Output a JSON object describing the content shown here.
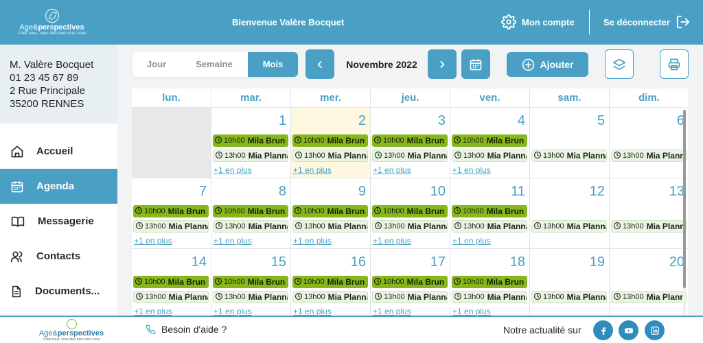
{
  "header": {
    "brand_part1": "Age&",
    "brand_part2": "perspectives",
    "brand_tagline": "Chez nous, vous êtes bien chez vous",
    "welcome": "Bienvenue Valère Bocquet",
    "account": "Mon compte",
    "logout": "Se déconnecter"
  },
  "sidebar": {
    "address": [
      "M. Valère Bocquet",
      "01 23 45 67 89",
      "2 Rue Principale",
      "35200 RENNES"
    ],
    "items": [
      {
        "label": "Accueil",
        "icon": "home-icon",
        "active": false
      },
      {
        "label": "Agenda",
        "icon": "calendar-icon",
        "active": true
      },
      {
        "label": "Messagerie",
        "icon": "book-icon",
        "active": false
      },
      {
        "label": "Contacts",
        "icon": "users-icon",
        "active": false
      },
      {
        "label": "Documents...",
        "icon": "document-icon",
        "active": false
      }
    ]
  },
  "toolbar": {
    "views": [
      "Jour",
      "Semaine",
      "Mois"
    ],
    "active_view": "Mois",
    "month": "Novembre 2022",
    "add": "Ajouter"
  },
  "calendar": {
    "weekdays": [
      "lun.",
      "mar.",
      "mer.",
      "jeu.",
      "ven.",
      "sam.",
      "dim."
    ],
    "weeks": [
      [
        {
          "day": "",
          "empty": true
        },
        {
          "day": "1",
          "events": [
            {
              "time": "10h00",
              "name": "Mila Brun",
              "kind": "green"
            },
            {
              "time": "13h00",
              "name": "Mia Plannat",
              "kind": "light"
            }
          ],
          "more": "+1 en plus"
        },
        {
          "day": "2",
          "today": true,
          "events": [
            {
              "time": "10h00",
              "name": "Mila Brun",
              "kind": "green"
            },
            {
              "time": "13h00",
              "name": "Mia Plannat",
              "kind": "light"
            }
          ],
          "more": "+1 en plus"
        },
        {
          "day": "3",
          "events": [
            {
              "time": "10h00",
              "name": "Mila Brun",
              "kind": "green"
            },
            {
              "time": "13h00",
              "name": "Mia Plannat",
              "kind": "light"
            }
          ],
          "more": "+1 en plus"
        },
        {
          "day": "4",
          "events": [
            {
              "time": "10h00",
              "name": "Mila Brun",
              "kind": "green"
            },
            {
              "time": "13h00",
              "name": "Mia Plannat",
              "kind": "light"
            }
          ],
          "more": "+1 en plus"
        },
        {
          "day": "5",
          "events": [
            {
              "time": "13h00",
              "name": "Mia Plannat",
              "kind": "light"
            }
          ]
        },
        {
          "day": "6",
          "events": [
            {
              "time": "13h00",
              "name": "Mia Plannat",
              "kind": "light"
            }
          ]
        }
      ],
      [
        {
          "day": "7",
          "events": [
            {
              "time": "10h00",
              "name": "Mila Brun",
              "kind": "green"
            },
            {
              "time": "13h00",
              "name": "Mia Plannat",
              "kind": "light"
            }
          ],
          "more": "+1 en plus"
        },
        {
          "day": "8",
          "events": [
            {
              "time": "10h00",
              "name": "Mila Brun",
              "kind": "green"
            },
            {
              "time": "13h00",
              "name": "Mia Plannat",
              "kind": "light"
            }
          ],
          "more": "+1 en plus"
        },
        {
          "day": "9",
          "events": [
            {
              "time": "10h00",
              "name": "Mila Brun",
              "kind": "green"
            },
            {
              "time": "13h00",
              "name": "Mia Plannat",
              "kind": "light"
            }
          ],
          "more": "+1 en plus"
        },
        {
          "day": "10",
          "events": [
            {
              "time": "10h00",
              "name": "Mila Brun",
              "kind": "green"
            },
            {
              "time": "13h00",
              "name": "Mia Plannat",
              "kind": "light"
            }
          ],
          "more": "+1 en plus"
        },
        {
          "day": "11",
          "events": [
            {
              "time": "10h00",
              "name": "Mila Brun",
              "kind": "green"
            },
            {
              "time": "13h00",
              "name": "Mia Plannat",
              "kind": "light"
            }
          ],
          "more": "+1 en plus"
        },
        {
          "day": "12",
          "events": [
            {
              "time": "13h00",
              "name": "Mia Plannat",
              "kind": "light"
            }
          ]
        },
        {
          "day": "13",
          "events": [
            {
              "time": "13h00",
              "name": "Mia Plannat",
              "kind": "light"
            }
          ]
        }
      ],
      [
        {
          "day": "14",
          "events": [
            {
              "time": "10h00",
              "name": "Mila Brun",
              "kind": "green"
            },
            {
              "time": "13h00",
              "name": "Mia Plannat",
              "kind": "light"
            }
          ],
          "more": "+1 en plus"
        },
        {
          "day": "15",
          "events": [
            {
              "time": "10h00",
              "name": "Mila Brun",
              "kind": "green"
            },
            {
              "time": "13h00",
              "name": "Mia Plannat",
              "kind": "light"
            }
          ],
          "more": "+1 en plus"
        },
        {
          "day": "16",
          "events": [
            {
              "time": "10h00",
              "name": "Mila Brun",
              "kind": "green"
            },
            {
              "time": "13h00",
              "name": "Mia Plannat",
              "kind": "light"
            }
          ],
          "more": "+1 en plus"
        },
        {
          "day": "17",
          "events": [
            {
              "time": "10h00",
              "name": "Mila Brun",
              "kind": "green"
            },
            {
              "time": "13h00",
              "name": "Mia Plannat",
              "kind": "light"
            }
          ],
          "more": "+1 en plus"
        },
        {
          "day": "18",
          "events": [
            {
              "time": "10h00",
              "name": "Mila Brun",
              "kind": "green"
            },
            {
              "time": "13h00",
              "name": "Mia Plannat",
              "kind": "light"
            }
          ],
          "more": "+1 en plus"
        },
        {
          "day": "19",
          "events": [
            {
              "time": "13h00",
              "name": "Mia Plannat",
              "kind": "light"
            }
          ]
        },
        {
          "day": "20",
          "events": [
            {
              "time": "13h00",
              "name": "Mia Plannat",
              "kind": "light"
            }
          ]
        }
      ]
    ]
  },
  "footer": {
    "help": "Besoin d'aide ?",
    "news": "Notre actualité sur",
    "socials": [
      "facebook-icon",
      "youtube-icon",
      "linkedin-icon"
    ]
  },
  "colors": {
    "primary": "#4aa0c4",
    "event_green": "#86b81e",
    "event_light": "#e9f5e2",
    "today": "#fdf8df",
    "empty_cell": "#e6e8ea"
  }
}
